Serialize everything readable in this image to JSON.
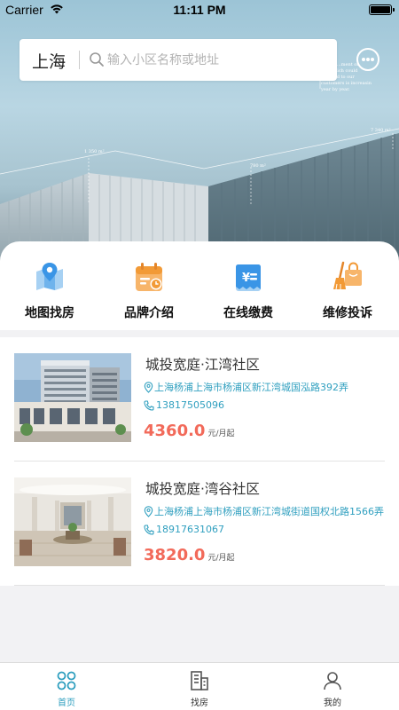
{
  "status_bar": {
    "carrier": "Carrier",
    "time": "11:11 PM"
  },
  "search": {
    "city": "上海",
    "placeholder": "输入小区名称或地址"
  },
  "hero_overlay": {
    "text_lines": [
      "...ment of",
      "...which could",
      "...ed to our",
      "customers is increasin",
      "year by year."
    ],
    "label_1": "1 350 m²",
    "label_2": "780 m²",
    "label_3": "7 340 m²"
  },
  "categories": [
    {
      "label": "地图找房",
      "icon": "map-pin-icon",
      "color": "#3a95e6"
    },
    {
      "label": "品牌介绍",
      "icon": "calendar-clock-icon",
      "color": "#f29a36"
    },
    {
      "label": "在线缴费",
      "icon": "yuan-bill-icon",
      "color": "#3a95e6"
    },
    {
      "label": "维修投诉",
      "icon": "broom-bag-icon",
      "color": "#f29a36"
    }
  ],
  "listings": [
    {
      "name": "城投宽庭·江湾社区",
      "address": "上海杨浦上海市杨浦区新江湾城国泓路392弄",
      "phone": "13817505096",
      "price": "4360.0",
      "unit": "元/月起"
    },
    {
      "name": "城投宽庭·湾谷社区",
      "address": "上海杨浦上海市杨浦区新江湾城街道国权北路1566弄",
      "phone": "18917631067",
      "price": "3820.0",
      "unit": "元/月起"
    }
  ],
  "tabs": [
    {
      "label": "首页",
      "icon": "home-grid-icon",
      "active": true
    },
    {
      "label": "找房",
      "icon": "buildings-icon",
      "active": false
    },
    {
      "label": "我的",
      "icon": "user-icon",
      "active": false
    }
  ],
  "colors": {
    "accent": "#2f9fbf",
    "price": "#f26a5a",
    "blue_icon": "#3a95e6",
    "orange_icon": "#f29a36"
  }
}
